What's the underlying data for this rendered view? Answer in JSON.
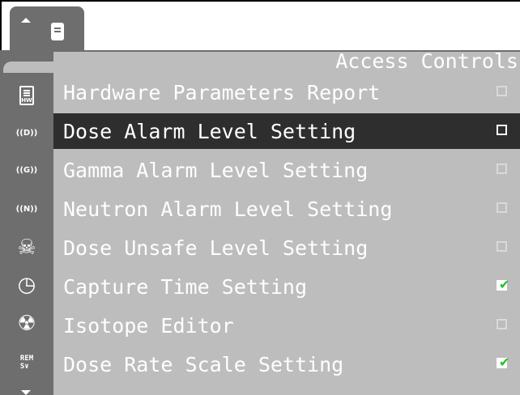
{
  "tabs": [
    {
      "icon": "document-icon",
      "active": true
    }
  ],
  "panel": {
    "title": "Access Controls"
  },
  "rail": {
    "items": [
      {
        "icon": "hardware-report-icon",
        "text": "HW"
      },
      {
        "icon": "dose-alarm-icon",
        "text": "((D))"
      },
      {
        "icon": "gamma-alarm-icon",
        "text": "((G))"
      },
      {
        "icon": "neutron-alarm-icon",
        "text": "((N))"
      },
      {
        "icon": "skull-crossbones-icon",
        "text": "☠"
      },
      {
        "icon": "clock-icon",
        "text": "◷"
      },
      {
        "icon": "radiation-icon",
        "text": "☢"
      },
      {
        "icon": "rem-sv-icon",
        "text": "REM\nS∨"
      }
    ]
  },
  "rows": [
    {
      "label": "Hardware Parameters Report",
      "checked": false,
      "selected": false
    },
    {
      "label": "Dose Alarm Level Setting",
      "checked": false,
      "selected": true
    },
    {
      "label": "Gamma Alarm Level Setting",
      "checked": false,
      "selected": false
    },
    {
      "label": "Neutron Alarm Level Setting",
      "checked": false,
      "selected": false
    },
    {
      "label": "Dose Unsafe Level Setting",
      "checked": false,
      "selected": false
    },
    {
      "label": "Capture Time Setting",
      "checked": true,
      "selected": false
    },
    {
      "label": "Isotope Editor",
      "checked": false,
      "selected": false
    },
    {
      "label": "Dose Rate Scale Setting",
      "checked": true,
      "selected": false
    }
  ],
  "colors": {
    "rail": "#6e6e6e",
    "panel": "#bdbdbd",
    "selected_row": "#2e2e2e",
    "check": "#22c02a"
  }
}
